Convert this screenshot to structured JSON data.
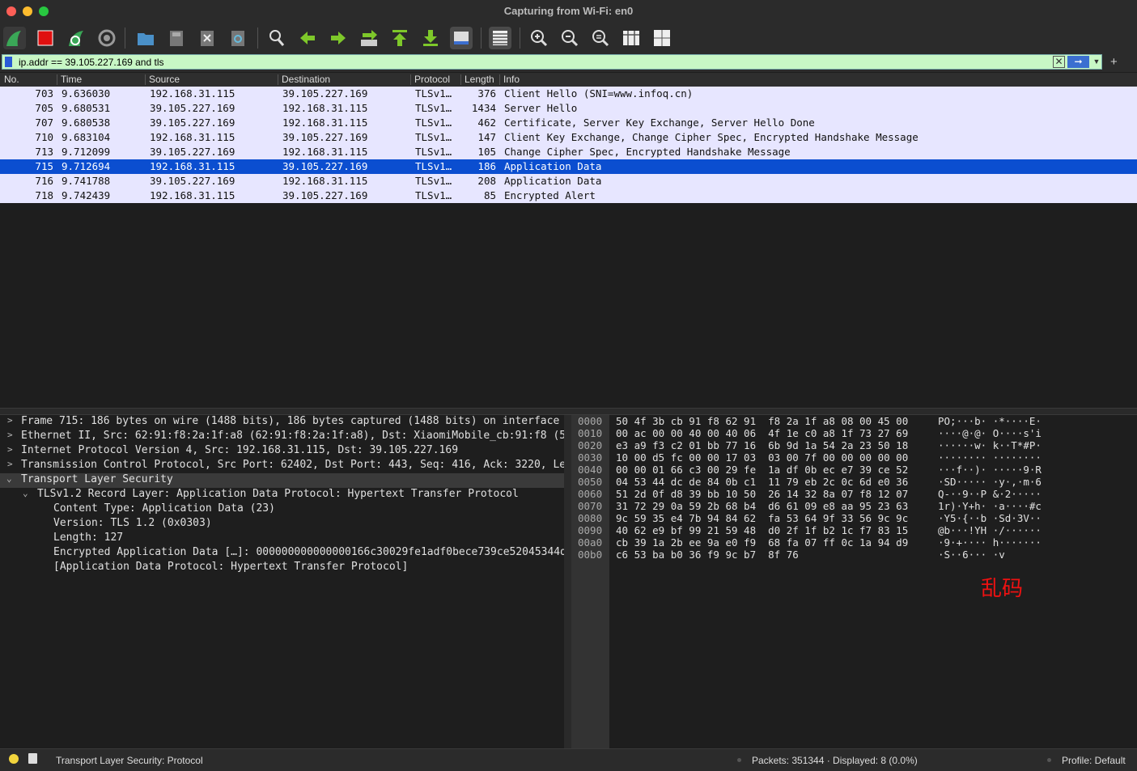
{
  "window": {
    "title": "Capturing from Wi-Fi: en0"
  },
  "toolbar": {
    "icons": [
      "shark-fin-start-icon",
      "stop-capture-icon",
      "restart-capture-icon",
      "capture-options-icon",
      "open-file-icon",
      "save-file-icon",
      "close-file-icon",
      "reload-file-icon",
      "find-packet-icon",
      "go-back-icon",
      "go-forward-icon",
      "go-to-packet-icon",
      "first-packet-icon",
      "last-packet-icon",
      "autoscroll-icon",
      "colorize-icon",
      "zoom-in-icon",
      "zoom-out-icon",
      "zoom-normal-icon",
      "resize-columns-icon",
      "layout-icon"
    ]
  },
  "filter": {
    "value": "ip.addr == 39.105.227.169 and tls",
    "add_label": "+"
  },
  "columns": [
    "No.",
    "Time",
    "Source",
    "Destination",
    "Protocol",
    "Length",
    "Info"
  ],
  "packets": [
    {
      "no": "703",
      "time": "9.636030",
      "src": "192.168.31.115",
      "dst": "39.105.227.169",
      "proto": "TLSv1…",
      "len": "376",
      "info": "Client Hello (SNI=www.infoq.cn)"
    },
    {
      "no": "705",
      "time": "9.680531",
      "src": "39.105.227.169",
      "dst": "192.168.31.115",
      "proto": "TLSv1…",
      "len": "1434",
      "info": "Server Hello"
    },
    {
      "no": "707",
      "time": "9.680538",
      "src": "39.105.227.169",
      "dst": "192.168.31.115",
      "proto": "TLSv1…",
      "len": "462",
      "info": "Certificate, Server Key Exchange, Server Hello Done"
    },
    {
      "no": "710",
      "time": "9.683104",
      "src": "192.168.31.115",
      "dst": "39.105.227.169",
      "proto": "TLSv1…",
      "len": "147",
      "info": "Client Key Exchange, Change Cipher Spec, Encrypted Handshake Message"
    },
    {
      "no": "713",
      "time": "9.712099",
      "src": "39.105.227.169",
      "dst": "192.168.31.115",
      "proto": "TLSv1…",
      "len": "105",
      "info": "Change Cipher Spec, Encrypted Handshake Message"
    },
    {
      "no": "715",
      "time": "9.712694",
      "src": "192.168.31.115",
      "dst": "39.105.227.169",
      "proto": "TLSv1…",
      "len": "186",
      "info": "Application Data"
    },
    {
      "no": "716",
      "time": "9.741788",
      "src": "39.105.227.169",
      "dst": "192.168.31.115",
      "proto": "TLSv1…",
      "len": "208",
      "info": "Application Data"
    },
    {
      "no": "718",
      "time": "9.742439",
      "src": "192.168.31.115",
      "dst": "39.105.227.169",
      "proto": "TLSv1…",
      "len": "85",
      "info": "Encrypted Alert"
    }
  ],
  "selected_packet": "715",
  "details": [
    {
      "indent": 0,
      "chevron": ">",
      "text": "Frame 715: 186 bytes on wire (1488 bits), 186 bytes captured (1488 bits) on interface"
    },
    {
      "indent": 0,
      "chevron": ">",
      "text": "Ethernet II, Src: 62:91:f8:2a:1f:a8 (62:91:f8:2a:1f:a8), Dst: XiaomiMobile_cb:91:f8 (5"
    },
    {
      "indent": 0,
      "chevron": ">",
      "text": "Internet Protocol Version 4, Src: 192.168.31.115, Dst: 39.105.227.169"
    },
    {
      "indent": 0,
      "chevron": ">",
      "text": "Transmission Control Protocol, Src Port: 62402, Dst Port: 443, Seq: 416, Ack: 3220, Le"
    },
    {
      "indent": 0,
      "chevron": "v",
      "text": "Transport Layer Security"
    },
    {
      "indent": 1,
      "chevron": "v",
      "text": "TLSv1.2 Record Layer: Application Data Protocol: Hypertext Transfer Protocol"
    },
    {
      "indent": 2,
      "chevron": "",
      "text": "Content Type: Application Data (23)"
    },
    {
      "indent": 2,
      "chevron": "",
      "text": "Version: TLS 1.2 (0x0303)"
    },
    {
      "indent": 2,
      "chevron": "",
      "text": "Length: 127"
    },
    {
      "indent": 2,
      "chevron": "",
      "text": "Encrypted Application Data […]: 000000000000000166c30029fe1adf0bece739ce52045344d"
    },
    {
      "indent": 2,
      "chevron": "",
      "text": "[Application Data Protocol: Hypertext Transfer Protocol]"
    }
  ],
  "hex": [
    {
      "off": "0000",
      "bytes": "50 4f 3b cb 91 f8 62 91  f8 2a 1f a8 08 00 45 00",
      "ascii": "PO;···b· ·*····E·"
    },
    {
      "off": "0010",
      "bytes": "00 ac 00 00 40 00 40 06  4f 1e c0 a8 1f 73 27 69",
      "ascii": "····@·@· O····s'i"
    },
    {
      "off": "0020",
      "bytes": "e3 a9 f3 c2 01 bb 77 16  6b 9d 1a 54 2a 23 50 18",
      "ascii": "······w· k··T*#P·"
    },
    {
      "off": "0030",
      "bytes": "10 00 d5 fc 00 00 17 03  03 00 7f 00 00 00 00 00",
      "ascii": "········ ········"
    },
    {
      "off": "0040",
      "bytes": "00 00 01 66 c3 00 29 fe  1a df 0b ec e7 39 ce 52",
      "ascii": "···f··)· ·····9·R"
    },
    {
      "off": "0050",
      "bytes": "04 53 44 dc de 84 0b c1  11 79 eb 2c 0c 6d e0 36",
      "ascii": "·SD····· ·y·,·m·6"
    },
    {
      "off": "0060",
      "bytes": "51 2d 0f d8 39 bb 10 50  26 14 32 8a 07 f8 12 07",
      "ascii": "Q-··9··P &·2·····"
    },
    {
      "off": "0070",
      "bytes": "31 72 29 0a 59 2b 68 b4  d6 61 09 e8 aa 95 23 63",
      "ascii": "1r)·Y+h· ·a····#c"
    },
    {
      "off": "0080",
      "bytes": "9c 59 35 e4 7b 94 84 62  fa 53 64 9f 33 56 9c 9c",
      "ascii": "·Y5·{··b ·Sd·3V··"
    },
    {
      "off": "0090",
      "bytes": "40 62 e9 bf 99 21 59 48  d0 2f 1f b2 1c f7 83 15",
      "ascii": "@b···!YH ·/······"
    },
    {
      "off": "00a0",
      "bytes": "cb 39 1a 2b ee 9a e0 f9  68 fa 07 ff 0c 1a 94 d9",
      "ascii": "·9·+···· h·······"
    },
    {
      "off": "00b0",
      "bytes": "c6 53 ba b0 36 f9 9c b7  8f 76",
      "ascii": "·S··6··· ·v"
    }
  ],
  "annotation": "乱码",
  "status": {
    "left": "Transport Layer Security: Protocol",
    "packets": "Packets: 351344 · Displayed: 8 (0.0%)",
    "profile": "Profile: Default"
  }
}
